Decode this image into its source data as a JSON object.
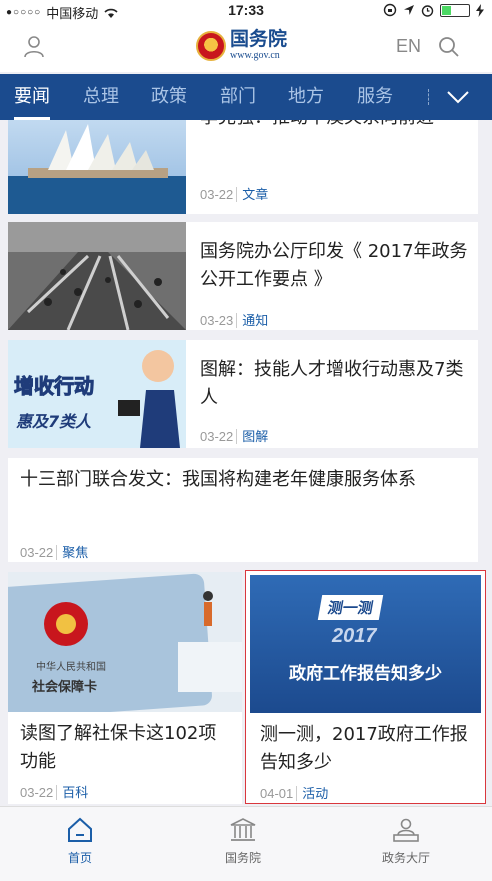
{
  "status_bar": {
    "carrier": "中国移动",
    "time": "17:33"
  },
  "header": {
    "logo_cn": "国务院",
    "logo_en": "www.gov.cn",
    "lang_label": "EN"
  },
  "nav": {
    "tabs": [
      "要闻",
      "总理",
      "政策",
      "部门",
      "地方",
      "服务"
    ],
    "active": "要闻"
  },
  "articles": [
    {
      "title": "李克强：推动中澳关系向前进",
      "date": "03-22",
      "tag": "文章"
    },
    {
      "title": "国务院办公厅印发《 2017年政务公开工作要点 》",
      "date": "03-23",
      "tag": "通知"
    },
    {
      "title": "图解：技能人才增收行动惠及7类人",
      "date": "03-22",
      "tag": "图解"
    },
    {
      "title": "十三部门联合发文：我国将构建老年健康服务体系",
      "date": "03-22",
      "tag": "聚焦"
    },
    {
      "title": "读图了解社保卡这102项功能",
      "date": "03-22",
      "tag": "百科"
    },
    {
      "title": "测一测，2017政府工作报告知多少",
      "date": "04-01",
      "tag": "活动"
    }
  ],
  "thumbs": {
    "infographic_line1": "增收行动",
    "infographic_line2": "惠及7类人",
    "card_line1": "中华人民共和国",
    "card_line2": "社会保障卡",
    "quiz_badge": "测一测",
    "quiz_year": "2017",
    "quiz_text": "政府工作报告知多少"
  },
  "tabbar": [
    {
      "label": "首页",
      "icon": "home-icon",
      "active": true
    },
    {
      "label": "国务院",
      "icon": "building-icon",
      "active": false
    },
    {
      "label": "政务大厅",
      "icon": "service-hall-icon",
      "active": false
    }
  ],
  "colors": {
    "brand": "#1b4b8e",
    "accent": "#1b5ea8",
    "highlight_border": "#d9373d"
  }
}
